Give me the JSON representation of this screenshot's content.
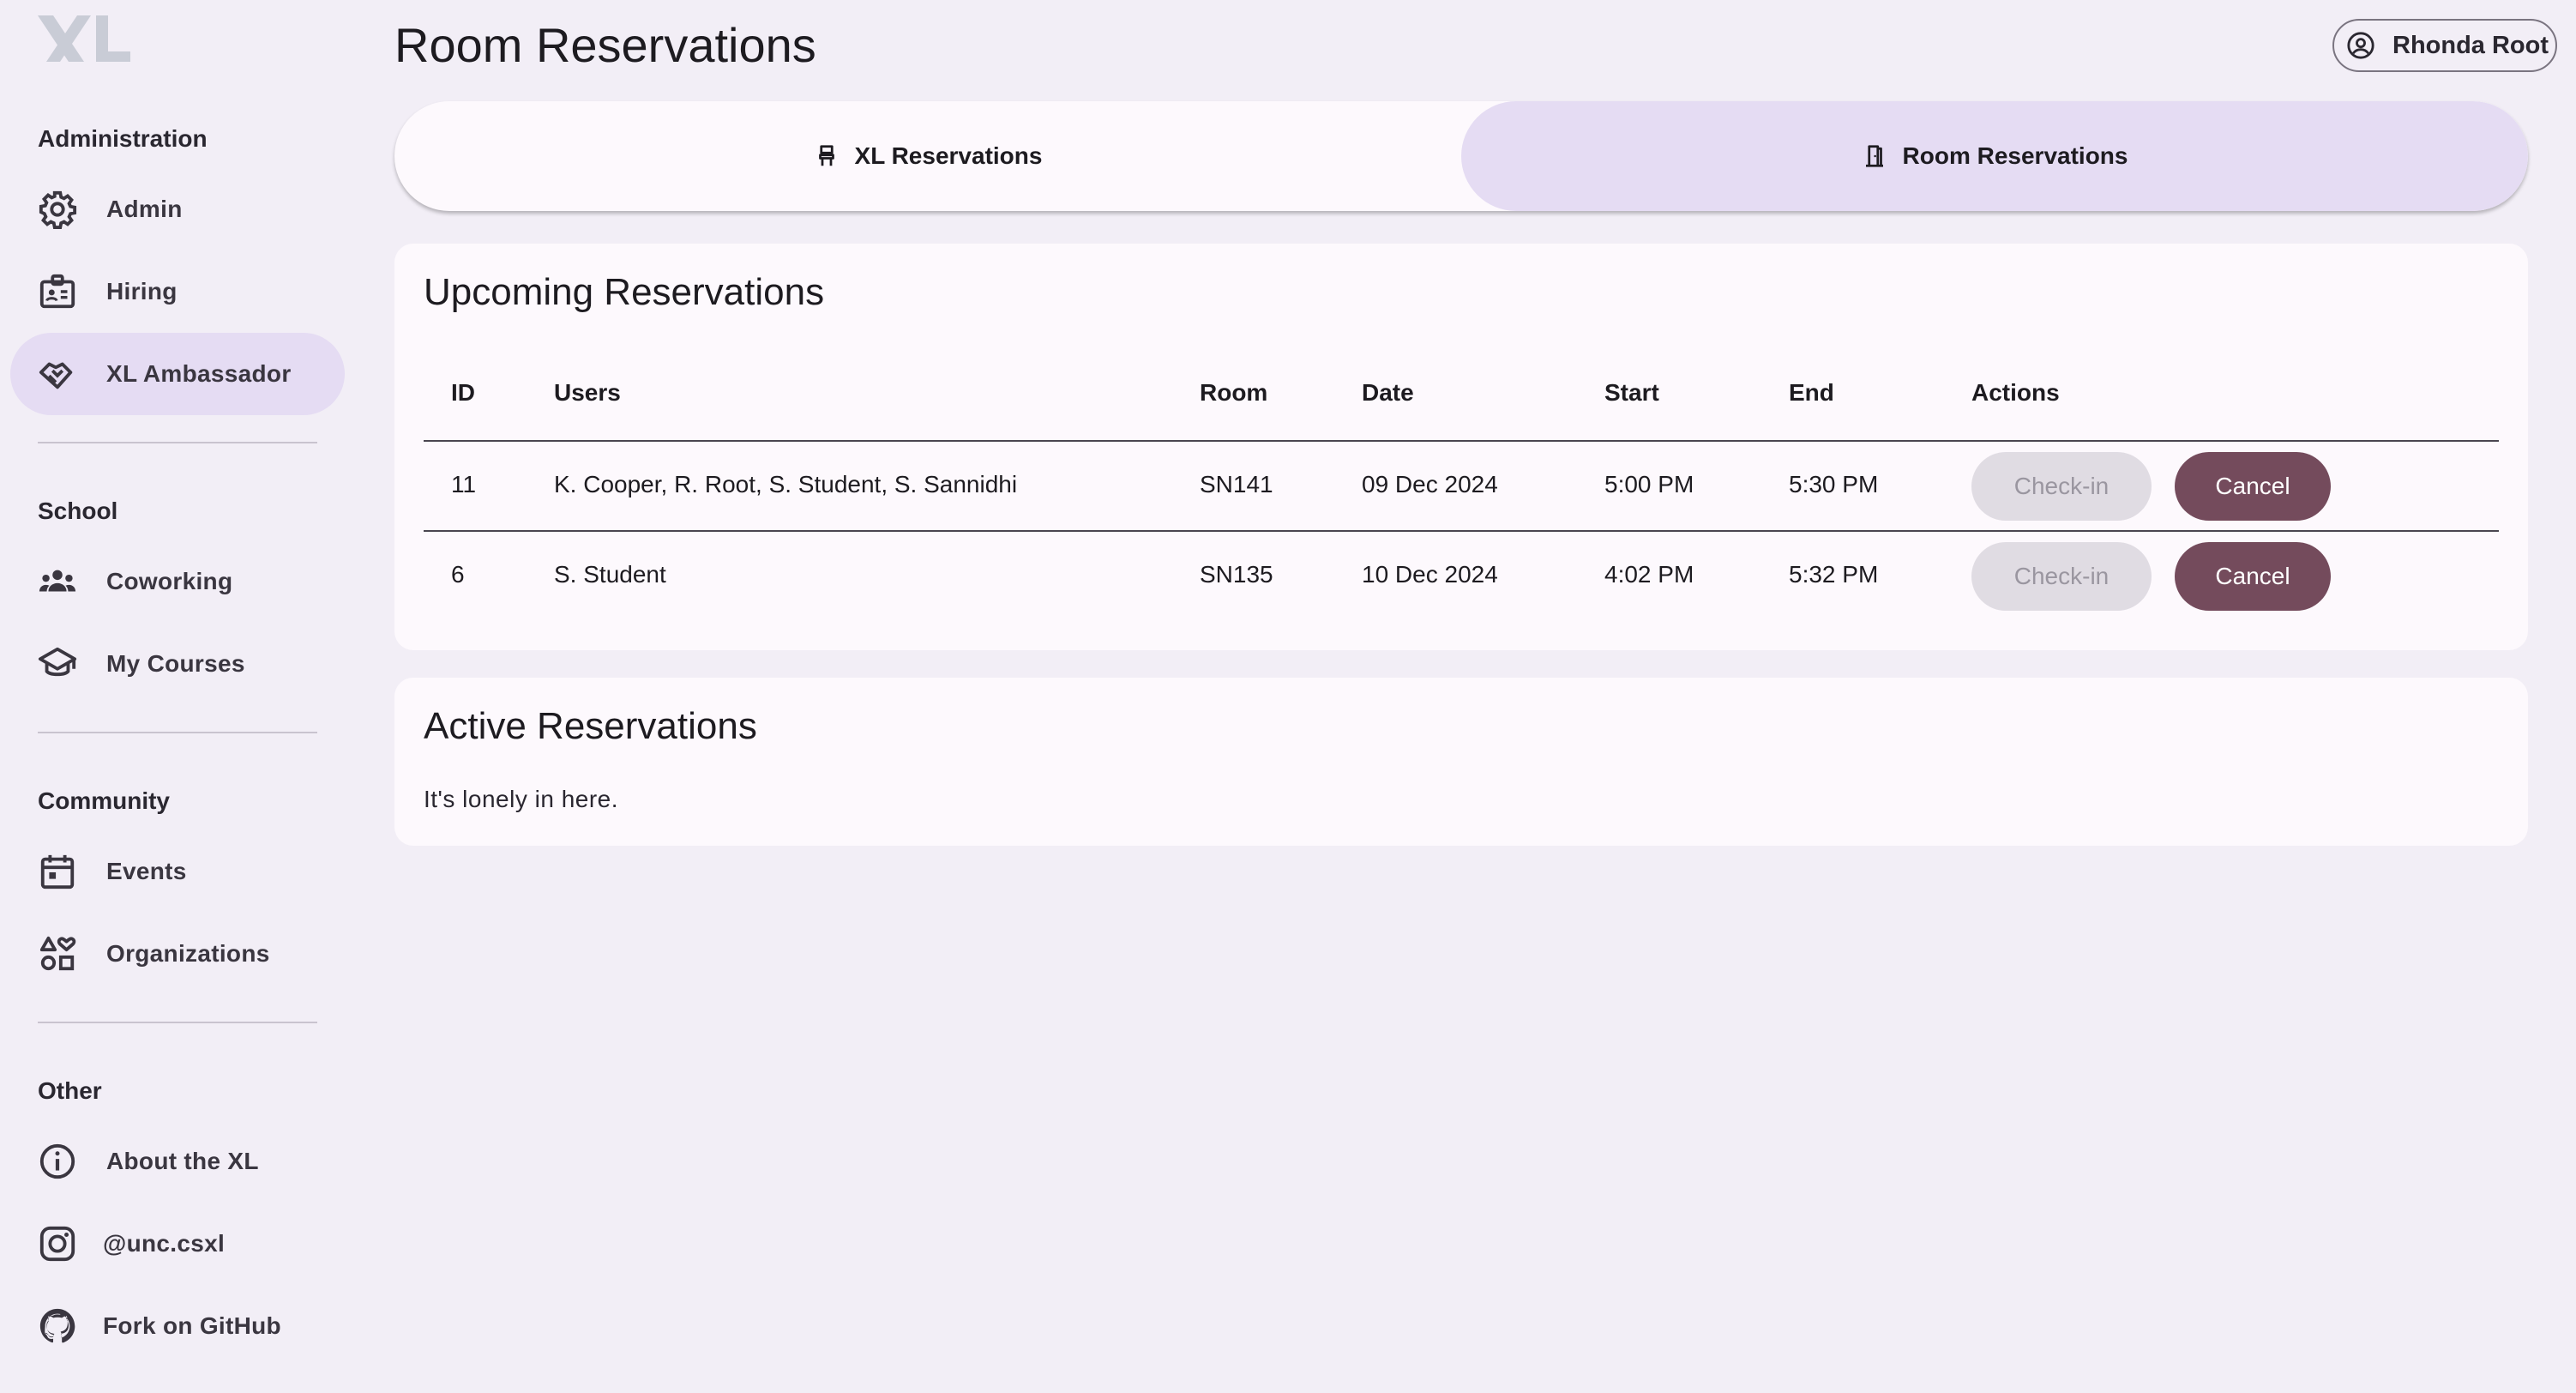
{
  "page": {
    "title": "Room Reservations"
  },
  "user": {
    "name": "Rhonda Root"
  },
  "sidebar": {
    "sections": [
      {
        "title": "Administration",
        "items": [
          {
            "label": "Admin",
            "icon": "gear-icon"
          },
          {
            "label": "Hiring",
            "icon": "id-badge-icon"
          },
          {
            "label": "XL Ambassador",
            "icon": "handshake-icon",
            "active": true
          }
        ]
      },
      {
        "title": "School",
        "items": [
          {
            "label": "Coworking",
            "icon": "group-icon"
          },
          {
            "label": "My Courses",
            "icon": "graduation-cap-icon"
          }
        ]
      },
      {
        "title": "Community",
        "items": [
          {
            "label": "Events",
            "icon": "calendar-icon"
          },
          {
            "label": "Organizations",
            "icon": "shapes-icon"
          }
        ]
      },
      {
        "title": "Other",
        "items": [
          {
            "label": "About the XL",
            "icon": "info-icon"
          },
          {
            "label": "@unc.csxl",
            "icon": "instagram-icon"
          },
          {
            "label": "Fork on GitHub",
            "icon": "github-icon"
          }
        ]
      }
    ]
  },
  "tabs": [
    {
      "label": "XL Reservations",
      "icon": "chair-icon",
      "selected": false
    },
    {
      "label": "Room Reservations",
      "icon": "door-icon",
      "selected": true
    }
  ],
  "upcoming": {
    "title": "Upcoming Reservations",
    "columns": [
      "ID",
      "Users",
      "Room",
      "Date",
      "Start",
      "End",
      "Actions"
    ],
    "rows": [
      {
        "id": "11",
        "users": "K. Cooper, R. Root, S. Student, S. Sannidhi",
        "room": "SN141",
        "date": "09 Dec 2024",
        "start": "5:00 PM",
        "end": "5:30 PM",
        "checkin": "Check-in",
        "cancel": "Cancel"
      },
      {
        "id": "6",
        "users": "S. Student",
        "room": "SN135",
        "date": "10 Dec 2024",
        "start": "4:02 PM",
        "end": "5:32 PM",
        "checkin": "Check-in",
        "cancel": "Cancel"
      }
    ]
  },
  "active": {
    "title": "Active Reservations",
    "empty_text": "It's lonely in here."
  },
  "colors": {
    "background": "#f2eef6",
    "active_nav": "#e5dcf3",
    "cancel_button": "#744b5c",
    "checkin_button": "#e0dce3"
  }
}
